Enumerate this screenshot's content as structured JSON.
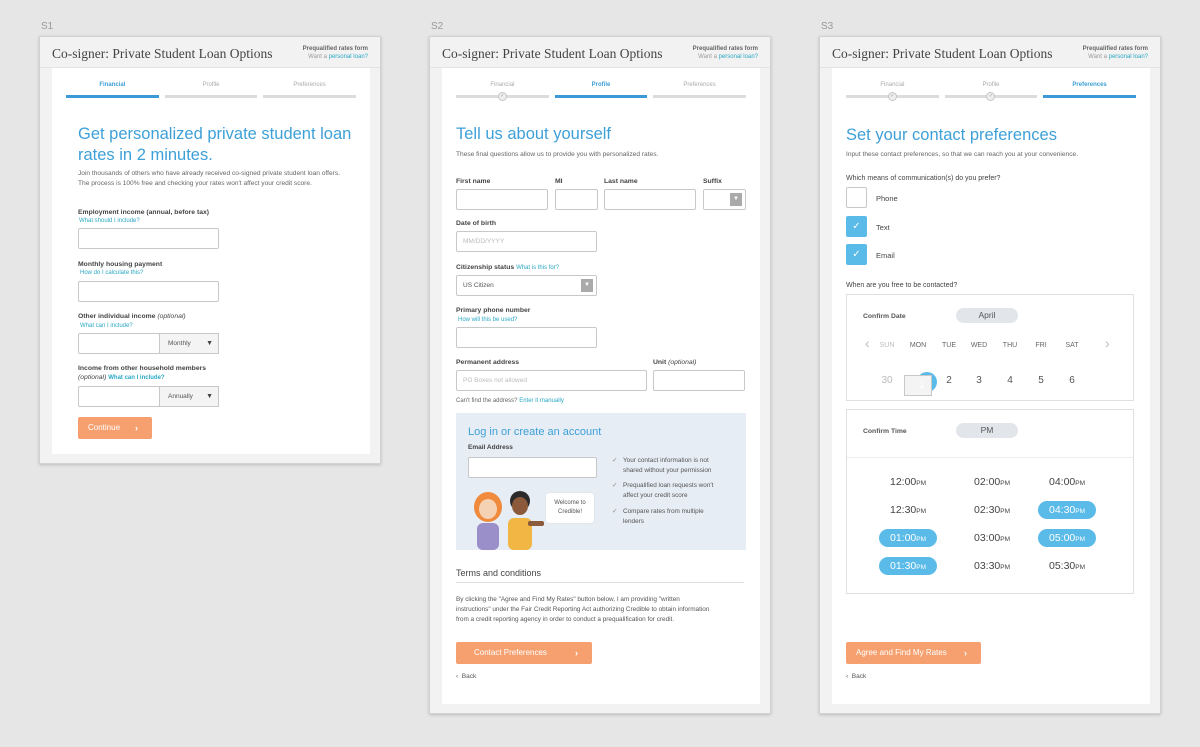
{
  "app_title": "Co-signer: Private Student Loan Options",
  "side_top": "Prequalified rates form",
  "side_prefix": "Want a ",
  "side_link": "personal loan?",
  "steps": [
    "Financial",
    "Profile",
    "Preferences"
  ],
  "back_label": "Back",
  "accent_color": "#3d9ad6",
  "cta_color": "#f6a070",
  "s1": {
    "label": "S1",
    "heading_line1": "Get personalized private student loan",
    "heading_line2": "rates in 2 minutes.",
    "intro_line1": "Join thousands of others who have already received co-signed private student loan offers.",
    "intro_line2": "The process is 100% free and checking your rates won't affect your credit score.",
    "employment_label": "Employment income (annual, before tax)",
    "employment_help": "What should I include?",
    "housing_label": "Monthly housing payment",
    "housing_help": "How do I calculate this?",
    "other_label": "Other individual income ",
    "other_optional": "(optional)",
    "other_help": "What can I include?",
    "other_freq": "Monthly",
    "household_label": "Income from other household members",
    "household_optional": "(optional)",
    "household_help": "What can I include?",
    "household_freq": "Annually",
    "continue_label": "Continue"
  },
  "s2": {
    "label": "S2",
    "heading": "Tell us about yourself",
    "intro": "These final questions allow us to provide you with personalized rates.",
    "first_name": "First name",
    "mi": "MI",
    "last_name": "Last name",
    "suffix": "Suffix",
    "dob_label": "Date of birth",
    "dob_placeholder": "MM/DD/YYYY",
    "citizenship_label": "Citizenship status",
    "citizenship_help": "What is this for?",
    "citizenship_value": "US Citizen",
    "phone_label": "Primary phone number",
    "phone_help": "How will this be used?",
    "address_label": "Permanent address",
    "address_placeholder": "PO Boxes not allowed",
    "unit_label": "Unit ",
    "unit_optional": "(optional)",
    "cant_find": "Can't find the address? ",
    "enter_manually": "Enter it manually",
    "login_title": "Log in or create an account",
    "email_label": "Email Address",
    "bullets": [
      [
        "Your contact information is not",
        "shared without your permission"
      ],
      [
        "Prequalified loan requests won't",
        "affect your credit score"
      ],
      [
        "Compare rates from multiple",
        "lenders"
      ]
    ],
    "bubble_line1": "Welcome to",
    "bubble_line2": "Credible!",
    "terms_heading": "Terms and conditions",
    "terms_line1": "By clicking the \"Agree and Find My Rates\" button below, I am providing \"written",
    "terms_line2": "instructions\" under the Fair Credit Reporting Act authorizing Credible to obtain information",
    "terms_line3": "from a credit reporting agency in order to conduct a prequalification for credit.",
    "cta_label": "Contact Preferences"
  },
  "s3": {
    "label": "S3",
    "heading": "Set your contact preferences",
    "intro": "Input these contact preferences, so that we can reach you at your convenience.",
    "comm_question": "Which means of communication(s) do you prefer?",
    "options": [
      {
        "label": "Phone",
        "checked": false
      },
      {
        "label": "Text",
        "checked": true
      },
      {
        "label": "Email",
        "checked": true
      }
    ],
    "when_question": "When are you free to be contacted?",
    "confirm_date": "Confirm Date",
    "month": "April",
    "days": [
      "SUN",
      "MON",
      "TUE",
      "WED",
      "THU",
      "FRI",
      "SAT"
    ],
    "dates": [
      "30",
      "1",
      "2",
      "3",
      "4",
      "5",
      "6"
    ],
    "selected_date": "1",
    "confirm_time": "Confirm Time",
    "period": "PM",
    "times": [
      {
        "t": "12:00",
        "ap": "PM",
        "on": false
      },
      {
        "t": "02:00",
        "ap": "PM",
        "on": false
      },
      {
        "t": "04:00",
        "ap": "PM",
        "on": false
      },
      {
        "t": "12:30",
        "ap": "PM",
        "on": false
      },
      {
        "t": "02:30",
        "ap": "PM",
        "on": false
      },
      {
        "t": "04:30",
        "ap": "PM",
        "on": true
      },
      {
        "t": "01:00",
        "ap": "PM",
        "on": true
      },
      {
        "t": "03:00",
        "ap": "PM",
        "on": false
      },
      {
        "t": "05:00",
        "ap": "PM",
        "on": true
      },
      {
        "t": "01:30",
        "ap": "PM",
        "on": true
      },
      {
        "t": "03:30",
        "ap": "PM",
        "on": false
      },
      {
        "t": "05:30",
        "ap": "PM",
        "on": false
      }
    ],
    "cta_label": "Agree and Find My Rates"
  }
}
